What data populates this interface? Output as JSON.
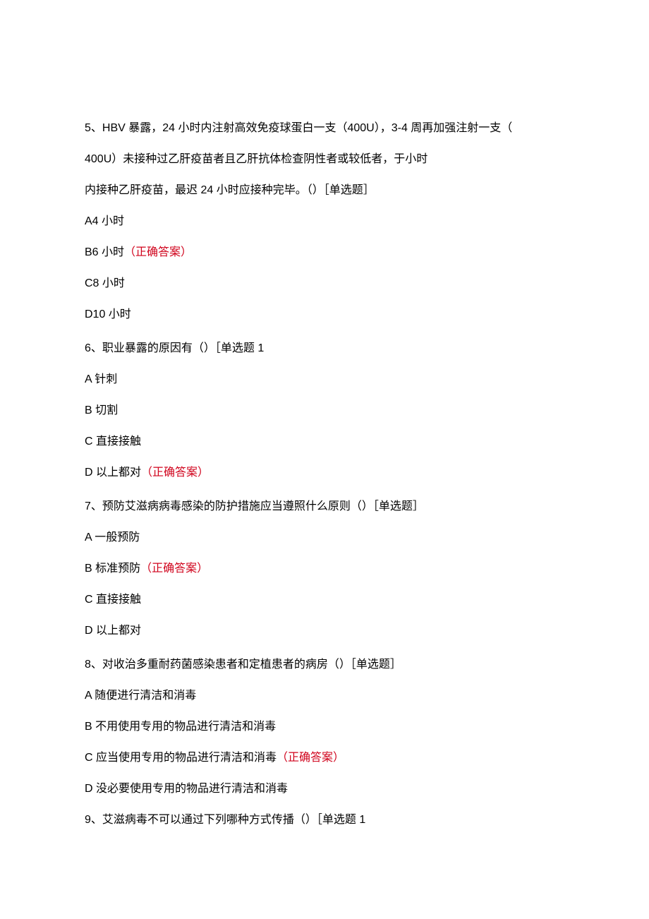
{
  "q5": {
    "stem_l1": "5、HBV 暴露，24 小时内注射高效免疫球蛋白一支（400U），3-4 周再加强注射一支（",
    "stem_l2": "400U）未接种过乙肝疫苗者且乙肝抗体检查阴性者或较低者，于小时",
    "stem_l3": "内接种乙肝疫苗，最迟 24 小时应接种完毕。（）［单选题］",
    "optA": "A4 小时",
    "optB_text": "B6 小时",
    "optB_ans": "（正确答案）",
    "optC": "C8 小时",
    "optD": "D10 小时"
  },
  "q6": {
    "stem": "6、职业暴露的原因有（）［单选题 1",
    "optA": "A 针刺",
    "optB": "B 切割",
    "optC": "C 直接接触",
    "optD_text": "D 以上都对",
    "optD_ans": "（正确答案）"
  },
  "q7": {
    "stem": "7、预防艾滋病病毒感染的防护措施应当遵照什么原则（）［单选题］",
    "optA": "A 一般预防",
    "optB_text": "B 标准预防",
    "optB_ans": "（正确答案）",
    "optC": "C 直接接触",
    "optD": "D 以上都对"
  },
  "q8": {
    "stem": "8、对收治多重耐药菌感染患者和定植患者的病房（）［单选题］",
    "optA": "A 随便进行清洁和消毒",
    "optB": "B 不用使用专用的物品进行清洁和消毒",
    "optC_text": "C 应当使用专用的物品进行清洁和消毒",
    "optC_ans": "（正确答案）",
    "optD": "D 没必要使用专用的物品进行清洁和消毒"
  },
  "q9": {
    "stem": "9、艾滋病毒不可以通过下列哪种方式传播（）［单选题 1"
  }
}
